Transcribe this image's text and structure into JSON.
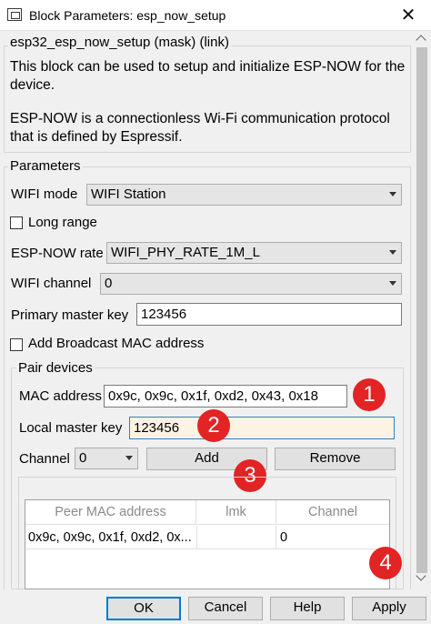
{
  "window": {
    "title": "Block Parameters: esp_now_setup",
    "close_glyph": "✕"
  },
  "mask_group": {
    "label": "esp32_esp_now_setup (mask) (link)",
    "description_1": [
      "This block can be used to setup and initialize ESP-NOW for the",
      "device."
    ],
    "description_2": [
      "ESP-NOW is a connectionless Wi-Fi communication protocol",
      "that is defined by Espressif."
    ]
  },
  "parameters": {
    "label": "Parameters",
    "wifi_mode": {
      "label": "WIFI mode",
      "value": "WIFI Station"
    },
    "long_range": {
      "label": "Long range",
      "checked": false
    },
    "espnow_rate": {
      "label": "ESP-NOW rate",
      "value": "WIFI_PHY_RATE_1M_L"
    },
    "wifi_channel": {
      "label": "WIFI channel",
      "value": "0"
    },
    "primary_master_key": {
      "label": "Primary master key",
      "value": "123456"
    },
    "add_broadcast": {
      "label": "Add Broadcast MAC address",
      "checked": false
    }
  },
  "pair_devices": {
    "label": "Pair devices",
    "mac_address": {
      "label": "MAC address",
      "value": "0x9c, 0x9c, 0x1f, 0xd2, 0x43, 0x18"
    },
    "local_master_key": {
      "label": "Local master key",
      "value": "123456"
    },
    "channel": {
      "label": "Channel",
      "value": "0"
    },
    "add_label": "Add",
    "remove_label": "Remove",
    "table": {
      "columns": [
        "Peer MAC address",
        "lmk",
        "Channel"
      ],
      "rows": [
        {
          "mac": "0x9c, 0x9c, 0x1f, 0xd2, 0x...",
          "lmk": "",
          "channel": "0"
        }
      ]
    }
  },
  "badges": [
    "1",
    "2",
    "3",
    "4"
  ],
  "badge_color": "#e22424",
  "buttons": {
    "ok": "OK",
    "cancel": "Cancel",
    "help": "Help",
    "apply": "Apply"
  }
}
